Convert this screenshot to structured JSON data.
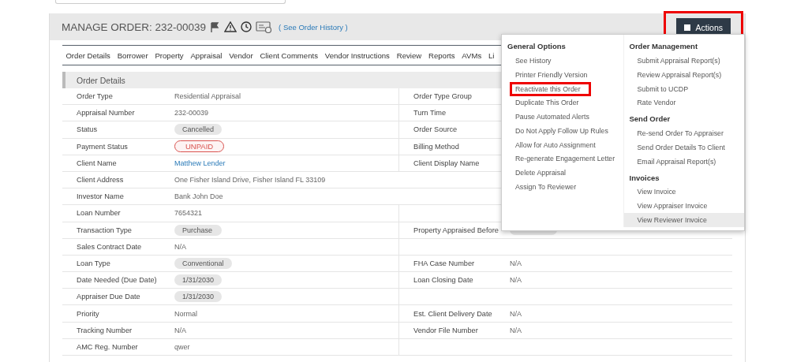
{
  "header": {
    "title": "MANAGE ORDER: 232-00039",
    "history_link": "( See Order History )",
    "actions_button": {
      "label": "Actions",
      "highlighted": true
    }
  },
  "tabs": [
    "Order Details",
    "Borrower",
    "Property",
    "Appraisal",
    "Vendor",
    "Client Comments",
    "Vendor Instructions",
    "Review",
    "Reports",
    "AVMs",
    "Li"
  ],
  "section": {
    "title": "Order Details"
  },
  "rows": [
    {
      "label": "Order Type",
      "value": {
        "kind": "text",
        "text": "Residential Appraisal"
      },
      "right": {
        "label": "Order Type Group"
      }
    },
    {
      "label": "Appraisal Number",
      "value": {
        "kind": "text",
        "text": "232-00039"
      },
      "right": {
        "label": "Turn Time"
      }
    },
    {
      "label": "Status",
      "value": {
        "kind": "pill",
        "text": "Cancelled"
      },
      "right": {
        "label": "Order Source"
      }
    },
    {
      "label": "Payment Status",
      "value": {
        "kind": "alert",
        "text": "UNPAID"
      },
      "right": {
        "label": "Billing Method"
      }
    },
    {
      "label": "Client Name",
      "value": {
        "kind": "link",
        "text": "Matthew Lender"
      },
      "right": {
        "label": "Client Display Name"
      }
    },
    {
      "label": "Client Address",
      "value": {
        "kind": "text",
        "text": "One Fisher Island Drive, Fisher Island FL 33109"
      },
      "span": true
    },
    {
      "label": "Investor Name",
      "value": {
        "kind": "text",
        "text": "Bank John Doe"
      },
      "span": true
    },
    {
      "label": "Loan Number",
      "value": {
        "kind": "text",
        "text": "7654321"
      },
      "span": false
    },
    {
      "label": "Transaction Type",
      "value": {
        "kind": "pill",
        "text": "Purchase"
      },
      "right": {
        "label": "Property Appraised Before",
        "value": {
          "kind": "pill"
        }
      }
    },
    {
      "label": "Sales Contract Date",
      "value": {
        "kind": "text",
        "text": "N/A"
      },
      "span": false
    },
    {
      "label": "Loan Type",
      "value": {
        "kind": "pill",
        "text": "Conventional"
      },
      "right": {
        "label": "FHA Case Number",
        "value": {
          "kind": "text",
          "text": "N/A"
        }
      }
    },
    {
      "label": "Date Needed (Due Date)",
      "value": {
        "kind": "pill",
        "text": "1/31/2030"
      },
      "right": {
        "label": "Loan Closing Date",
        "value": {
          "kind": "text",
          "text": "N/A"
        }
      }
    },
    {
      "label": "Appraiser Due Date",
      "value": {
        "kind": "pill",
        "text": "1/31/2030"
      },
      "span": false
    },
    {
      "label": "Priority",
      "value": {
        "kind": "text",
        "text": "Normal"
      },
      "right": {
        "label": "Est. Client Delivery Date",
        "value": {
          "kind": "text",
          "text": "N/A"
        }
      }
    },
    {
      "label": "Tracking Number",
      "value": {
        "kind": "text",
        "text": "N/A"
      },
      "right": {
        "label": "Vendor File Number",
        "value": {
          "kind": "text",
          "text": "N/A"
        }
      }
    },
    {
      "label": "AMC Reg. Number",
      "value": {
        "kind": "text",
        "text": "qwer"
      },
      "span": false
    }
  ],
  "actions_menu": {
    "columns": [
      [
        {
          "heading": "General Options",
          "items": [
            {
              "label": "See History",
              "highlighted": false,
              "hovered": false
            },
            {
              "label": "Printer Friendly Version",
              "highlighted": false,
              "hovered": false
            },
            {
              "label": "Reactivate this Order",
              "highlighted": true,
              "hovered": false
            },
            {
              "label": "Duplicate This Order",
              "highlighted": false,
              "hovered": false
            },
            {
              "label": "Pause Automated Alerts",
              "highlighted": false,
              "hovered": false
            },
            {
              "label": "Do Not Apply Follow Up Rules",
              "highlighted": false,
              "hovered": false
            },
            {
              "label": "Allow for Auto Assignment",
              "highlighted": false,
              "hovered": false
            },
            {
              "label": "Re-generate Engagement Letter",
              "highlighted": false,
              "hovered": false
            },
            {
              "label": "Delete Appraisal",
              "highlighted": false,
              "hovered": false
            },
            {
              "label": "Assign To Reviewer",
              "highlighted": false,
              "hovered": false
            }
          ]
        }
      ],
      [
        {
          "heading": "Order Management",
          "items": [
            {
              "label": "Submit Appraisal Report(s)",
              "highlighted": false,
              "hovered": false
            },
            {
              "label": "Review Appraisal Report(s)",
              "highlighted": false,
              "hovered": false
            },
            {
              "label": "Submit to UCDP",
              "highlighted": false,
              "hovered": false
            },
            {
              "label": "Rate Vendor",
              "highlighted": false,
              "hovered": false
            }
          ]
        },
        {
          "heading": "Send Order",
          "items": [
            {
              "label": "Re-send Order To Appraiser",
              "highlighted": false,
              "hovered": false
            },
            {
              "label": "Send Order Details To Client",
              "highlighted": false,
              "hovered": false
            },
            {
              "label": "Email Appraisal Report(s)",
              "highlighted": false,
              "hovered": false
            }
          ]
        },
        {
          "heading": "Invoices",
          "items": [
            {
              "label": "View Invoice",
              "highlighted": false,
              "hovered": false
            },
            {
              "label": "View Appraiser Invoice",
              "highlighted": false,
              "hovered": false
            },
            {
              "label": "View Reviewer Invoice",
              "highlighted": false,
              "hovered": true
            }
          ]
        }
      ]
    ]
  }
}
